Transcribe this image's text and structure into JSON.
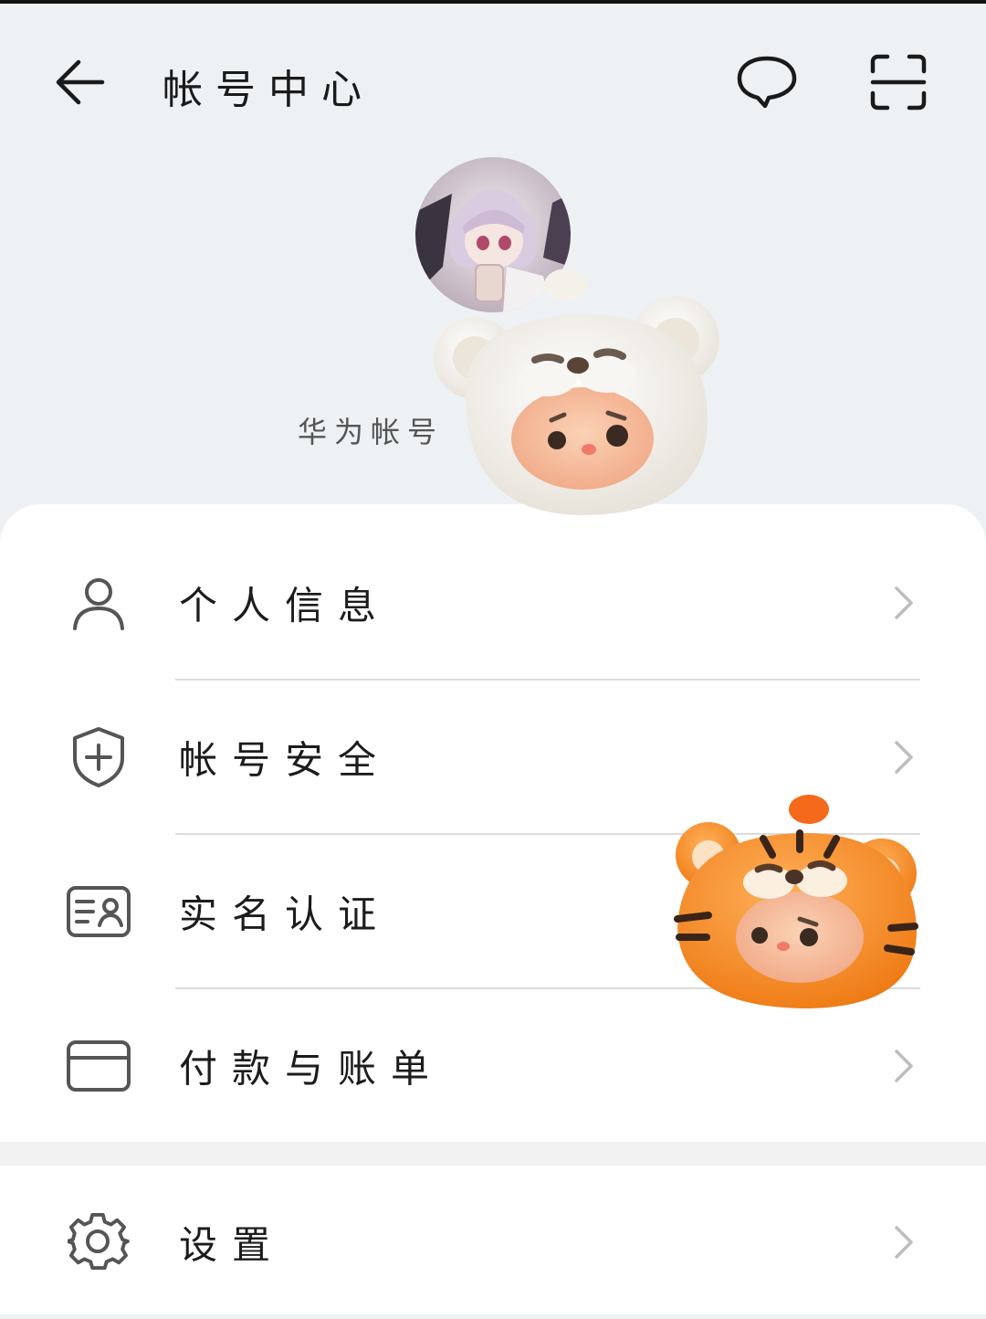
{
  "header": {
    "title": "帐号中心",
    "back_icon": "arrow-left-icon",
    "chat_icon": "chat-bubble-icon",
    "scan_icon": "scan-icon"
  },
  "profile": {
    "account_name": "华为帐号"
  },
  "menu": [
    {
      "label": "个人信息",
      "icon": "person-icon"
    },
    {
      "label": "帐号安全",
      "icon": "shield-plus-icon"
    },
    {
      "label": "实名认证",
      "icon": "id-card-icon"
    },
    {
      "label": "付款与账单",
      "icon": "credit-card-icon"
    }
  ],
  "settings": {
    "label": "设置",
    "icon": "gear-icon"
  },
  "colors": {
    "background": "#eef1f3",
    "card": "#ffffff",
    "icon": "#555555",
    "chevron": "#bdbdbd",
    "orange_tiger": "#f28a24"
  }
}
